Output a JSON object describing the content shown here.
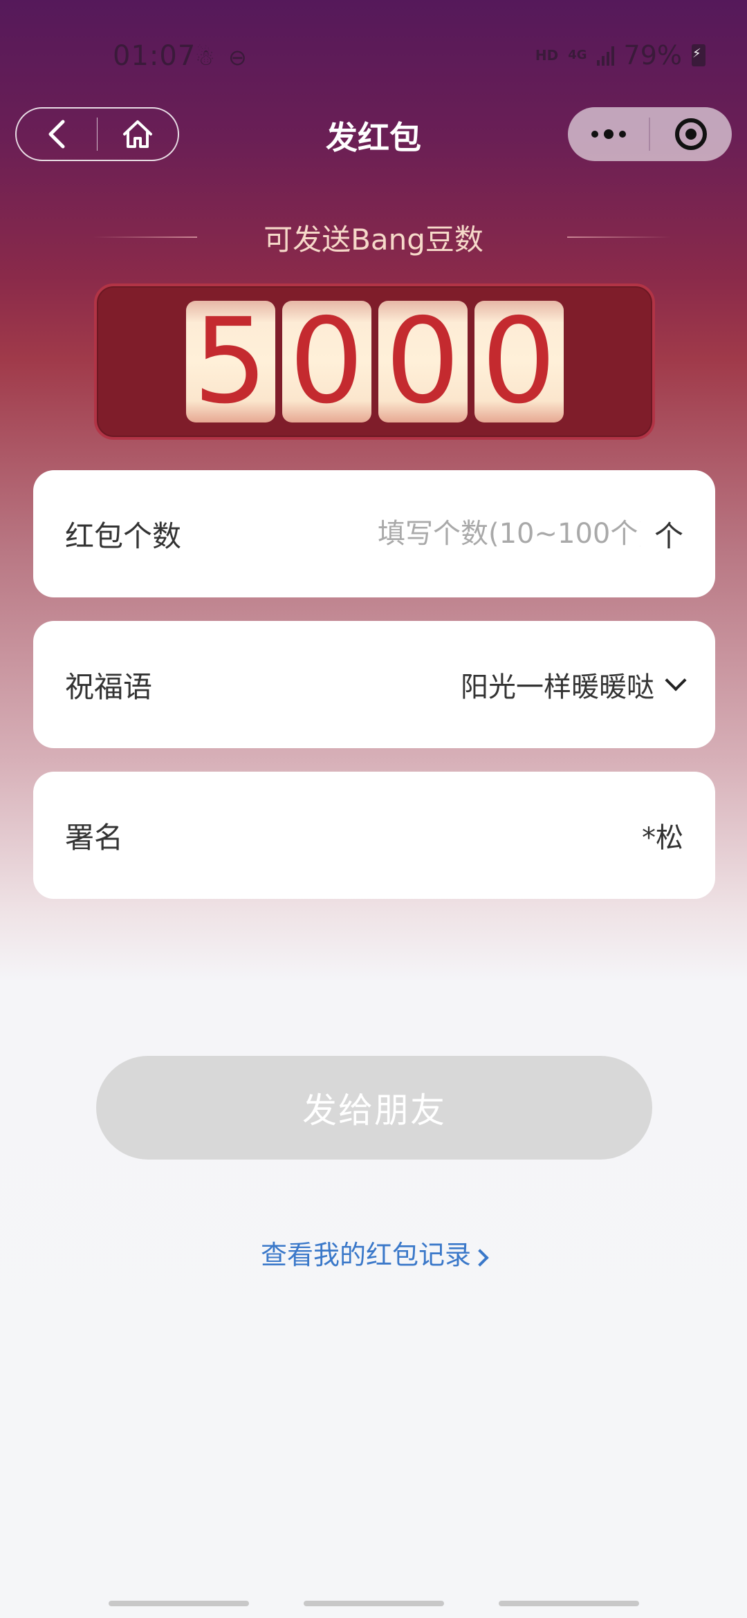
{
  "status_bar": {
    "time": "01:07",
    "hd": "HD",
    "network": "4G",
    "battery": "79%"
  },
  "nav": {
    "title": "发红包"
  },
  "balance": {
    "label": "可发送Bang豆数",
    "digits": [
      "5",
      "0",
      "0",
      "0"
    ]
  },
  "form": {
    "count": {
      "label": "红包个数",
      "placeholder": "填写个数(10~100个)",
      "value": "",
      "unit": "个"
    },
    "blessing": {
      "label": "祝福语",
      "value": "阳光一样暖暖哒"
    },
    "signature": {
      "label": "署名",
      "value": "*松"
    }
  },
  "actions": {
    "send": "发给朋友",
    "records_link": "查看我的红包记录"
  },
  "colors": {
    "accent_red": "#c42a2f",
    "counter_bg": "#7f1d2a",
    "link_blue": "#3a78c9",
    "disabled_button": "#d8d8d8"
  }
}
